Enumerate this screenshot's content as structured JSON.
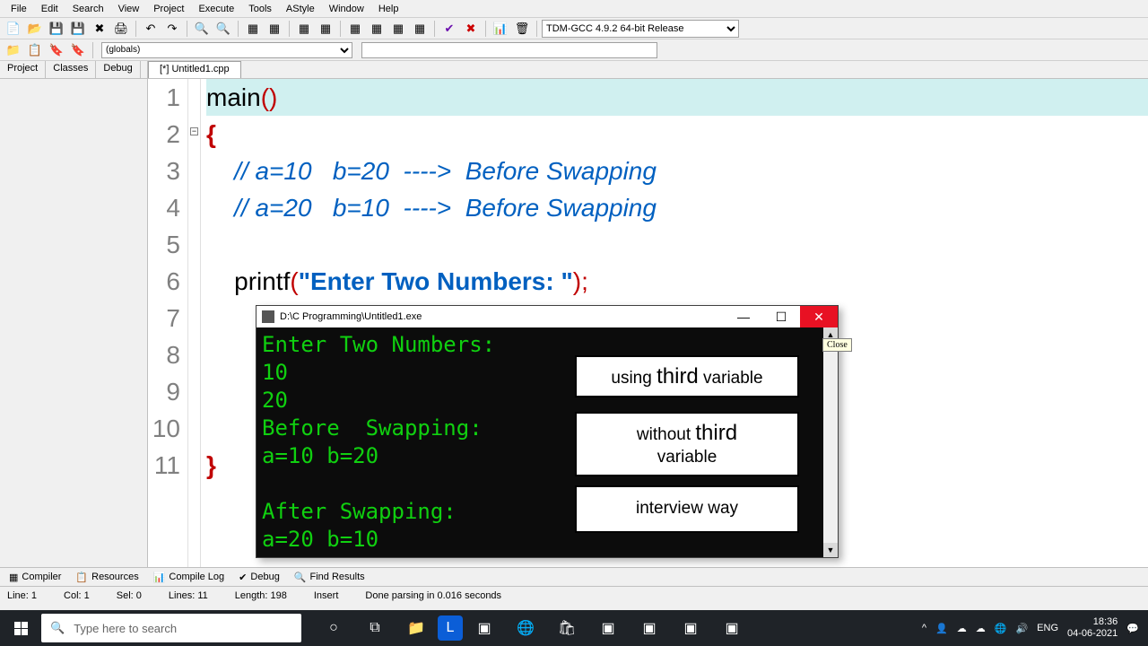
{
  "menu": [
    "File",
    "Edit",
    "Search",
    "View",
    "Project",
    "Execute",
    "Tools",
    "AStyle",
    "Window",
    "Help"
  ],
  "compiler": "TDM-GCC 4.9.2 64-bit Release",
  "globals": "(globals)",
  "sidebar_tabs": [
    "Project",
    "Classes",
    "Debug"
  ],
  "file_tab": "[*] Untitled1.cpp",
  "code": {
    "lines": [
      "1",
      "2",
      "3",
      "4",
      "5",
      "6",
      "7",
      "8",
      "9",
      "10",
      "11"
    ],
    "l1_main": "main",
    "l1_paren": "()",
    "l2": "{",
    "l3": "    // a=10   b=20  ---->  Before Swapping",
    "l4": "    // a=20   b=10  ---->  Before Swapping",
    "l6_printf": "    printf",
    "l6_paren1": "(",
    "l6_str": "\"Enter Two Numbers: \"",
    "l6_paren2": ")",
    "l6_semi": ";",
    "l11": "}"
  },
  "console": {
    "title": "D:\\C Programming\\Untitled1.exe",
    "min": "—",
    "max": "☐",
    "close": "✕",
    "tooltip": "Close",
    "body": "Enter Two Numbers:\n10\n20\nBefore  Swapping:\na=10 b=20\n\nAfter Swapping:\na=20 b=10",
    "annot1_a": "using ",
    "annot1_b": "third",
    "annot1_c": " variable",
    "annot2_a": "without ",
    "annot2_b": "third",
    "annot2_c": "variable",
    "annot3": "interview way"
  },
  "bottom_tabs": {
    "compiler": "Compiler",
    "resources": "Resources",
    "compile_log": "Compile Log",
    "debug": "Debug",
    "find": "Find Results"
  },
  "status": {
    "line": "Line:   1",
    "col": "Col:   1",
    "sel": "Sel:   0",
    "lines": "Lines:   11",
    "length": "Length:   198",
    "insert": "Insert",
    "parse": "Done parsing in 0.016 seconds"
  },
  "taskbar": {
    "search_placeholder": "Type here to search",
    "lang": "ENG",
    "time": "18:36",
    "date": "04-06-2021"
  }
}
